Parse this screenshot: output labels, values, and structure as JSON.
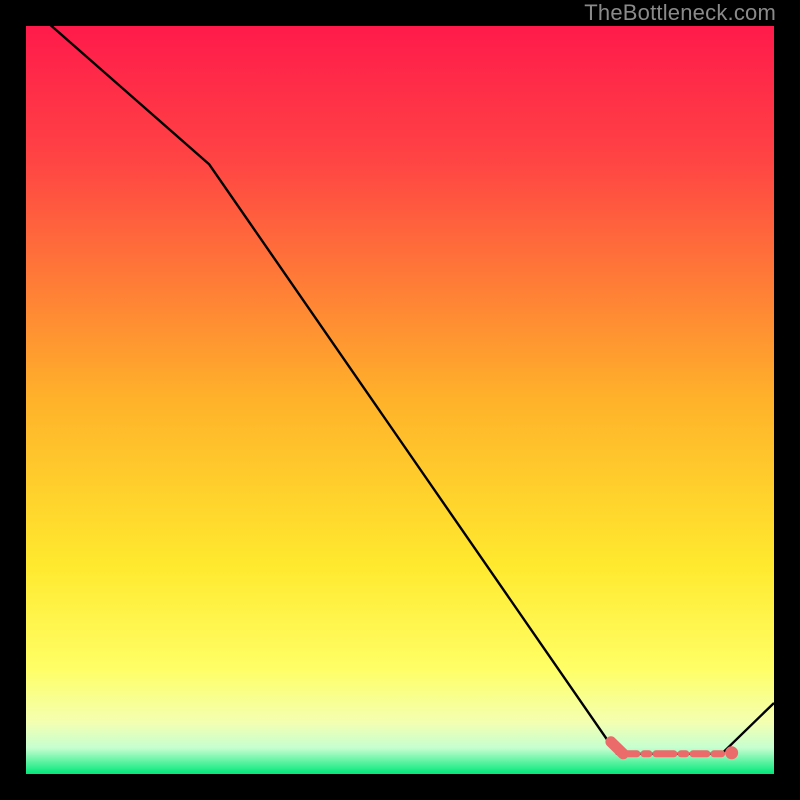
{
  "watermark": "TheBottleneck.com",
  "chart_data": {
    "type": "line",
    "title": "",
    "xlabel": "",
    "ylabel": "",
    "xlim": [
      0,
      100
    ],
    "ylim": [
      0,
      100
    ],
    "series": [
      {
        "name": "bottleneck-curve",
        "x": [
          0,
          24.5,
          79,
          93,
          100
        ],
        "values": [
          103,
          81.5,
          2.7,
          2.7,
          9.5
        ]
      }
    ],
    "markers": [
      {
        "name": "flat-region-start",
        "x": 79,
        "y": 2.7
      },
      {
        "name": "flat-region-end",
        "x": 93,
        "y": 2.7
      }
    ],
    "annotations": [],
    "grid": false,
    "legend": false,
    "background": {
      "type": "vertical-gradient",
      "stops": [
        {
          "pos": 0.0,
          "color": "#ff1a4b"
        },
        {
          "pos": 0.18,
          "color": "#ff4444"
        },
        {
          "pos": 0.5,
          "color": "#ffb22a"
        },
        {
          "pos": 0.72,
          "color": "#ffe92e"
        },
        {
          "pos": 0.86,
          "color": "#ffff66"
        },
        {
          "pos": 0.93,
          "color": "#f4ffb0"
        },
        {
          "pos": 0.965,
          "color": "#c6ffd0"
        },
        {
          "pos": 1.0,
          "color": "#00e87a"
        }
      ]
    }
  }
}
